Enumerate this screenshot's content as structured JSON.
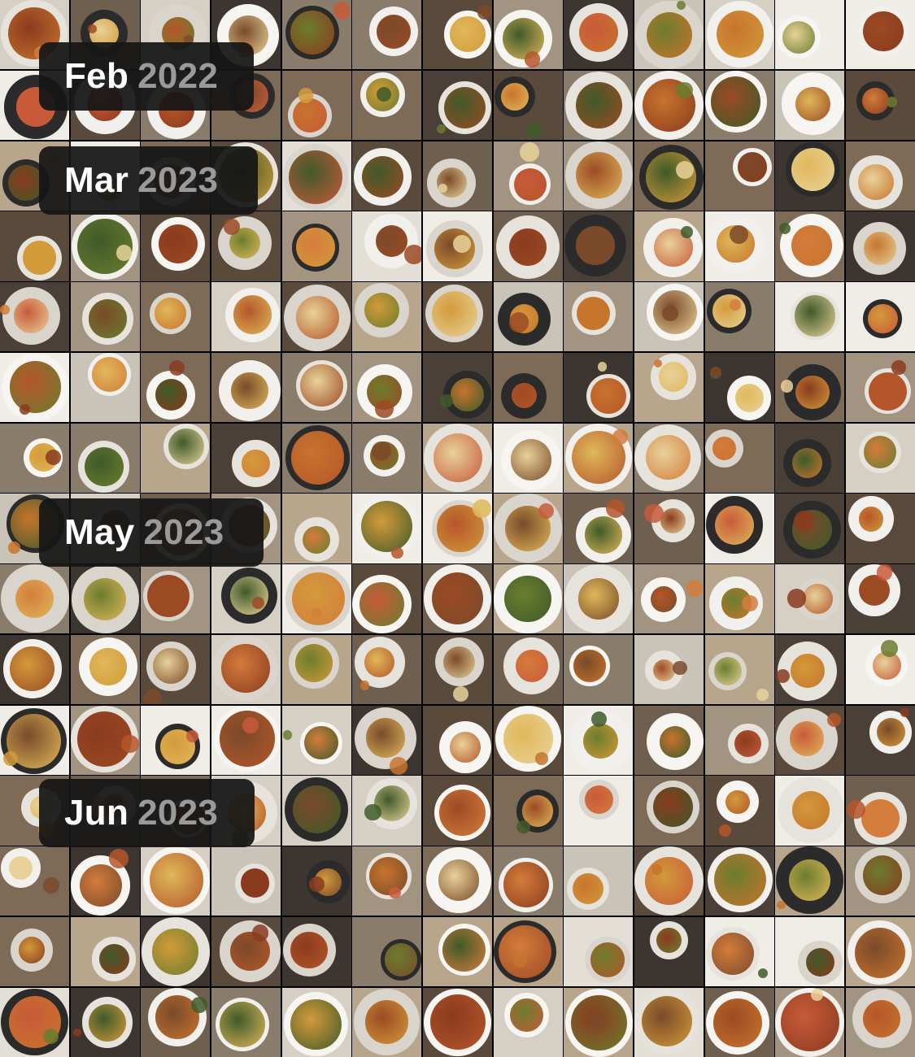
{
  "photo_grid": {
    "columns": 13,
    "rows": 15
  },
  "section_labels": [
    {
      "month": "Feb",
      "year": "2022"
    },
    {
      "month": "Mar",
      "year": "2023"
    },
    {
      "month": "May",
      "year": "2023"
    },
    {
      "month": "Jun",
      "year": "2023"
    }
  ]
}
